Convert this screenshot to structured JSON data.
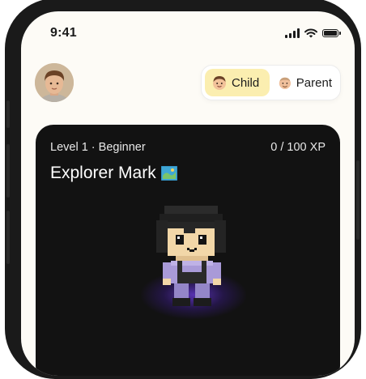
{
  "status_bar": {
    "time": "9:41"
  },
  "profile_toggle": {
    "options": [
      {
        "label": "Child",
        "selected": true
      },
      {
        "label": "Parent",
        "selected": false
      }
    ]
  },
  "progress_card": {
    "level_text": "Level 1 · Beginner",
    "xp_text": "0 / 100 XP",
    "xp_current": 0,
    "xp_max": 100,
    "title": "Explorer Mark"
  },
  "colors": {
    "screen_bg": "#fdfbf6",
    "card_bg": "#121212",
    "toggle_selected_bg": "#fbeeb0",
    "glow": "#6e3ce6",
    "character_shirt": "#a99ad8"
  },
  "icons": {
    "avatar": "child-avatar-photo",
    "child_option": "child-face-icon",
    "parent_option": "parent-face-icon",
    "title": "map-icon",
    "wifi": "wifi-icon",
    "signal": "signal-icon",
    "battery": "battery-icon"
  }
}
